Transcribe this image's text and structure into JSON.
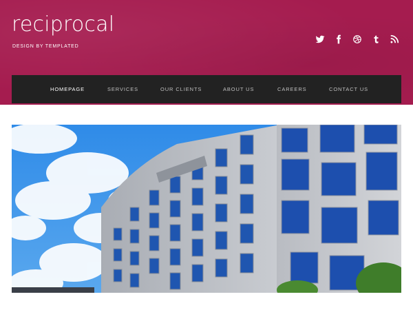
{
  "site": {
    "title": "reciprocal",
    "tagline": "DESIGN BY TEMPLATED"
  },
  "social": [
    {
      "icon": "twitter-icon"
    },
    {
      "icon": "facebook-icon"
    },
    {
      "icon": "dribbble-icon"
    },
    {
      "icon": "tumblr-icon"
    },
    {
      "icon": "rss-icon"
    }
  ],
  "nav": {
    "items": [
      {
        "label": "HOMEPAGE",
        "active": true
      },
      {
        "label": "SERVICES",
        "active": false
      },
      {
        "label": "OUR CLIENTS",
        "active": false
      },
      {
        "label": "ABOUT US",
        "active": false
      },
      {
        "label": "CAREERS",
        "active": false
      },
      {
        "label": "CONTACT US",
        "active": false
      }
    ]
  },
  "colors": {
    "header": "#a51c4f",
    "nav": "#222222",
    "accent": "#ffffff"
  }
}
